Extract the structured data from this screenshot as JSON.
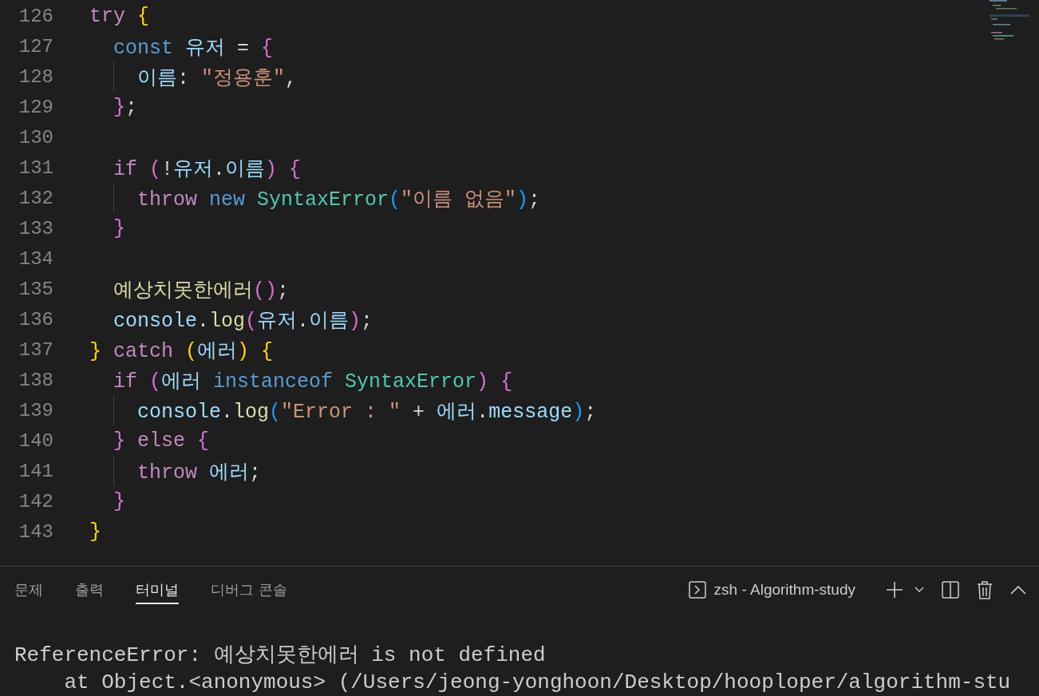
{
  "editor": {
    "lines": [
      {
        "number": "126",
        "tokens": [
          {
            "text": "try ",
            "kind": "control"
          },
          {
            "text": "{",
            "kind": "bracket1"
          }
        ],
        "children": [
          {
            "number": "127",
            "tokens": [
              {
                "text": "const ",
                "kind": "storage"
              },
              {
                "text": "유저",
                "kind": "variable"
              },
              {
                "text": " = ",
                "kind": "plain"
              },
              {
                "text": "{",
                "kind": "bracket2"
              }
            ],
            "children": [
              {
                "number": "128",
                "tokens": [
                  {
                    "text": "이름",
                    "kind": "variable"
                  },
                  {
                    "text": ": ",
                    "kind": "plain"
                  },
                  {
                    "text": "\"정용훈\"",
                    "kind": "string"
                  },
                  {
                    "text": ",",
                    "kind": "plain"
                  }
                ]
              }
            ]
          },
          {
            "number": "129",
            "tokens": [
              {
                "text": "}",
                "kind": "bracket2"
              },
              {
                "text": ";",
                "kind": "plain"
              }
            ]
          },
          {
            "number": "130"
          },
          {
            "number": "131",
            "tokens": [
              {
                "text": "if ",
                "kind": "control"
              },
              {
                "text": "(",
                "kind": "bracket2"
              },
              {
                "text": "!",
                "kind": "plain"
              },
              {
                "text": "유저",
                "kind": "variable"
              },
              {
                "text": ".",
                "kind": "plain"
              },
              {
                "text": "이름",
                "kind": "variable"
              },
              {
                "text": ") ",
                "kind": "bracket2"
              },
              {
                "text": "{",
                "kind": "bracket2"
              }
            ],
            "children": [
              {
                "number": "132",
                "tokens": [
                  {
                    "text": "throw ",
                    "kind": "control"
                  },
                  {
                    "text": "new ",
                    "kind": "storage"
                  },
                  {
                    "text": "SyntaxError",
                    "kind": "class"
                  },
                  {
                    "text": "(",
                    "kind": "bracket3"
                  },
                  {
                    "text": "\"이름 없음\"",
                    "kind": "string"
                  },
                  {
                    "text": ")",
                    "kind": "bracket3"
                  },
                  {
                    "text": ";",
                    "kind": "plain"
                  }
                ]
              }
            ]
          },
          {
            "number": "133",
            "tokens": [
              {
                "text": "}",
                "kind": "bracket2"
              }
            ]
          },
          {
            "number": "134"
          },
          {
            "number": "135",
            "tokens": [
              {
                "text": "예상치못한에러",
                "kind": "function"
              },
              {
                "text": "()",
                "kind": "bracket2"
              },
              {
                "text": ";",
                "kind": "plain"
              }
            ]
          },
          {
            "number": "136",
            "tokens": [
              {
                "text": "console",
                "kind": "variable"
              },
              {
                "text": ".",
                "kind": "plain"
              },
              {
                "text": "log",
                "kind": "function"
              },
              {
                "text": "(",
                "kind": "bracket2"
              },
              {
                "text": "유저",
                "kind": "variable"
              },
              {
                "text": ".",
                "kind": "plain"
              },
              {
                "text": "이름",
                "kind": "variable"
              },
              {
                "text": ")",
                "kind": "bracket2"
              },
              {
                "text": ";",
                "kind": "plain"
              }
            ]
          }
        ]
      },
      {
        "number": "137",
        "tokens": [
          {
            "text": "}",
            "kind": "bracket1"
          },
          {
            "text": " catch ",
            "kind": "control"
          },
          {
            "text": "(",
            "kind": "bracket1"
          },
          {
            "text": "에러",
            "kind": "variable"
          },
          {
            "text": ") ",
            "kind": "bracket1"
          },
          {
            "text": "{",
            "kind": "bracket1"
          }
        ],
        "children": [
          {
            "number": "138",
            "tokens": [
              {
                "text": "if ",
                "kind": "control"
              },
              {
                "text": "(",
                "kind": "bracket2"
              },
              {
                "text": "에러 ",
                "kind": "variable"
              },
              {
                "text": "instanceof ",
                "kind": "storage"
              },
              {
                "text": "SyntaxError",
                "kind": "class"
              },
              {
                "text": ") ",
                "kind": "bracket2"
              },
              {
                "text": "{",
                "kind": "bracket2"
              }
            ],
            "children": [
              {
                "number": "139",
                "tokens": [
                  {
                    "text": "console",
                    "kind": "variable"
                  },
                  {
                    "text": ".",
                    "kind": "plain"
                  },
                  {
                    "text": "log",
                    "kind": "function"
                  },
                  {
                    "text": "(",
                    "kind": "bracket3"
                  },
                  {
                    "text": "\"Error : \"",
                    "kind": "string"
                  },
                  {
                    "text": " + ",
                    "kind": "plain"
                  },
                  {
                    "text": "에러",
                    "kind": "variable"
                  },
                  {
                    "text": ".",
                    "kind": "plain"
                  },
                  {
                    "text": "message",
                    "kind": "variable"
                  },
                  {
                    "text": ")",
                    "kind": "bracket3"
                  },
                  {
                    "text": ";",
                    "kind": "plain"
                  }
                ]
              }
            ]
          },
          {
            "number": "140",
            "tokens": [
              {
                "text": "} ",
                "kind": "bracket2"
              },
              {
                "text": "else ",
                "kind": "control"
              },
              {
                "text": "{",
                "kind": "bracket2"
              }
            ],
            "children": [
              {
                "number": "141",
                "tokens": [
                  {
                    "text": "throw ",
                    "kind": "control"
                  },
                  {
                    "text": "에러",
                    "kind": "variable"
                  },
                  {
                    "text": ";",
                    "kind": "plain"
                  }
                ]
              }
            ]
          },
          {
            "number": "142",
            "tokens": [
              {
                "text": "}",
                "kind": "bracket2"
              }
            ]
          }
        ]
      },
      {
        "number": "143",
        "tokens": [
          {
            "text": "}",
            "kind": "bracket1"
          }
        ]
      }
    ]
  },
  "panel": {
    "tabs": [
      {
        "label": "문제",
        "selected": false
      },
      {
        "label": "출력",
        "selected": false
      },
      {
        "label": "터미널",
        "selected": true
      },
      {
        "label": "디버그 콘솔",
        "selected": false
      }
    ],
    "terminal_name": "zsh - Algorithm-study",
    "terminal_lines": [
      "ReferenceError: 예상치못한에러 is not defined",
      "    at Object.<anonymous> (/Users/jeong-yonghoon/Desktop/hooploper/algorithm-stu"
    ]
  }
}
